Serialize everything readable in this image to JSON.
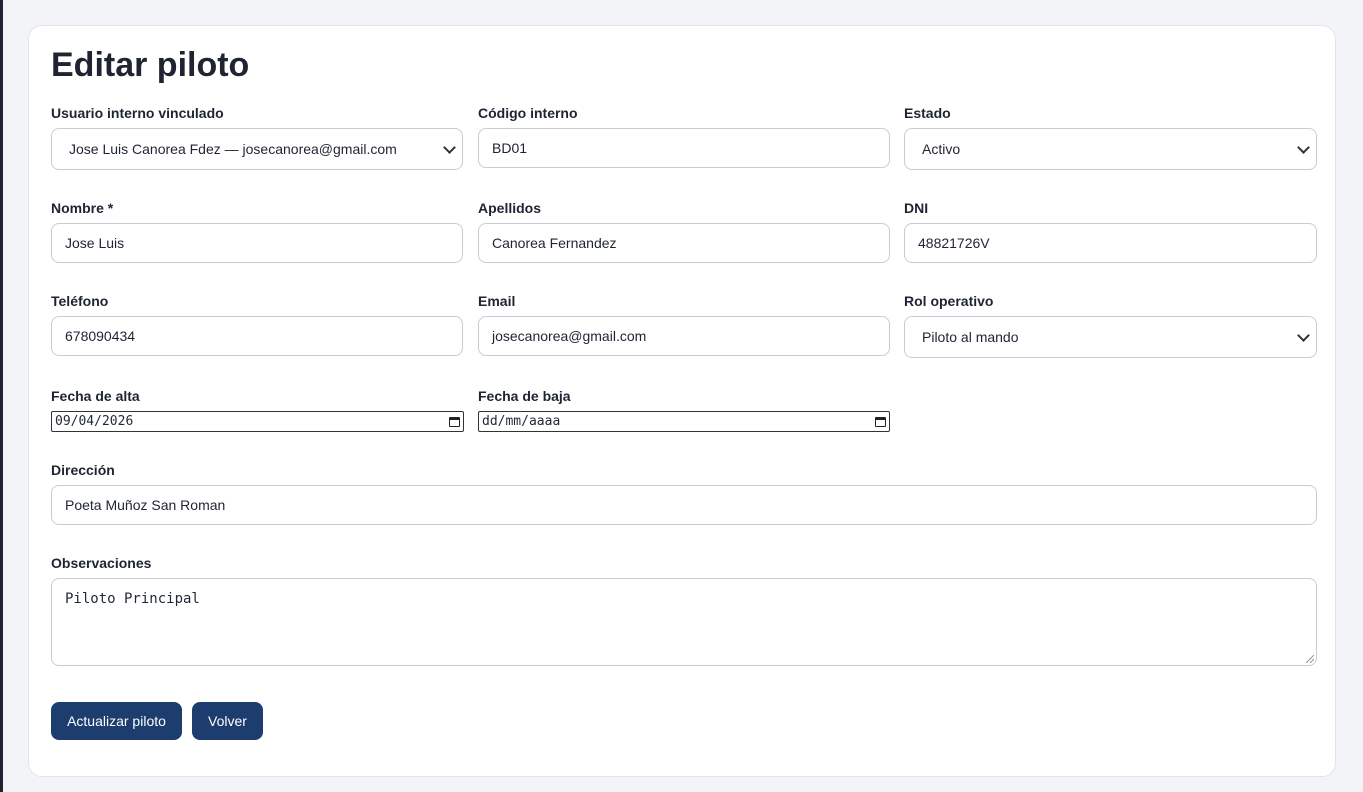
{
  "page": {
    "title": "Editar piloto"
  },
  "fields": {
    "usuario": {
      "label": "Usuario interno vinculado",
      "value": "Jose Luis Canorea Fdez — josecanorea@gmail.com"
    },
    "codigo": {
      "label": "Código interno",
      "value": "BD01"
    },
    "estado": {
      "label": "Estado",
      "value": "Activo"
    },
    "nombre": {
      "label": "Nombre *",
      "value": "Jose Luis"
    },
    "apellidos": {
      "label": "Apellidos",
      "value": "Canorea Fernandez"
    },
    "dni": {
      "label": "DNI",
      "value": "48821726V"
    },
    "telefono": {
      "label": "Teléfono",
      "value": "678090434"
    },
    "email": {
      "label": "Email",
      "value": "josecanorea@gmail.com"
    },
    "rol": {
      "label": "Rol operativo",
      "value": "Piloto al mando"
    },
    "fecha_alta": {
      "label": "Fecha de alta",
      "value": "09/04/2026"
    },
    "fecha_baja": {
      "label": "Fecha de baja",
      "value": "dd/mm/aaaa"
    },
    "direccion": {
      "label": "Dirección",
      "value": "Poeta Muñoz San Roman"
    },
    "observaciones": {
      "label": "Observaciones",
      "value": "Piloto Principal"
    }
  },
  "actions": {
    "update_label": "Actualizar piloto",
    "back_label": "Volver"
  },
  "colors": {
    "primary": "#1c3d6e",
    "background": "#f3f4f8",
    "card": "#ffffff"
  },
  "icons": {
    "select_arrow": "chevron-down-icon",
    "date_picker": "calendar-icon"
  }
}
